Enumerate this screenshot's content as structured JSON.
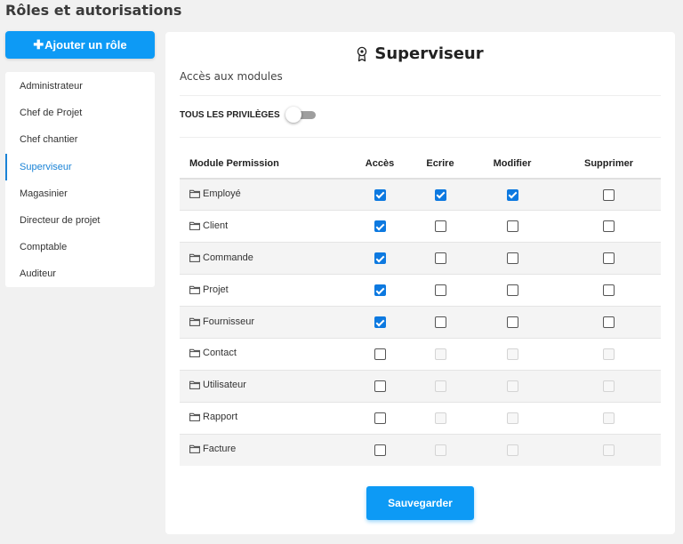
{
  "page": {
    "title": "Rôles et autorisations"
  },
  "add_role_button": {
    "icon": "plus-icon",
    "label": "Ajouter un rôle"
  },
  "roles": [
    {
      "label": "Administrateur",
      "active": false
    },
    {
      "label": "Chef de Projet",
      "active": false
    },
    {
      "label": "Chef chantier",
      "active": false
    },
    {
      "label": "Superviseur",
      "active": true
    },
    {
      "label": "Magasinier",
      "active": false
    },
    {
      "label": "Directeur de projet",
      "active": false
    },
    {
      "label": "Comptable",
      "active": false
    },
    {
      "label": "Auditeur",
      "active": false
    }
  ],
  "card": {
    "role_icon": "award-ribbon-icon",
    "role_name": "Superviseur",
    "section_label": "Accès aux modules",
    "all_privileges_label": "TOUS LES PRIVILÈGES",
    "all_privileges_on": false,
    "columns": [
      "Module Permission",
      "Accès",
      "Ecrire",
      "Modifier",
      "Supprimer"
    ],
    "modules": [
      {
        "name": "Employé",
        "acces": true,
        "ecrire": true,
        "modifier": true,
        "supprimer": false,
        "enabled": true
      },
      {
        "name": "Client",
        "acces": true,
        "ecrire": false,
        "modifier": false,
        "supprimer": false,
        "enabled": true
      },
      {
        "name": "Commande",
        "acces": true,
        "ecrire": false,
        "modifier": false,
        "supprimer": false,
        "enabled": true
      },
      {
        "name": "Projet",
        "acces": true,
        "ecrire": false,
        "modifier": false,
        "supprimer": false,
        "enabled": true
      },
      {
        "name": "Fournisseur",
        "acces": true,
        "ecrire": false,
        "modifier": false,
        "supprimer": false,
        "enabled": true
      },
      {
        "name": "Contact",
        "acces": false,
        "ecrire": false,
        "modifier": false,
        "supprimer": false,
        "enabled": false
      },
      {
        "name": "Utilisateur",
        "acces": false,
        "ecrire": false,
        "modifier": false,
        "supprimer": false,
        "enabled": false
      },
      {
        "name": "Rapport",
        "acces": false,
        "ecrire": false,
        "modifier": false,
        "supprimer": false,
        "enabled": false
      },
      {
        "name": "Facture",
        "acces": false,
        "ecrire": false,
        "modifier": false,
        "supprimer": false,
        "enabled": false
      }
    ],
    "save_label": "Sauvegarder"
  },
  "colors": {
    "accent": "#0d9af5",
    "active_nav": "#1a83d6",
    "checkbox_on": "#0d79e0"
  }
}
